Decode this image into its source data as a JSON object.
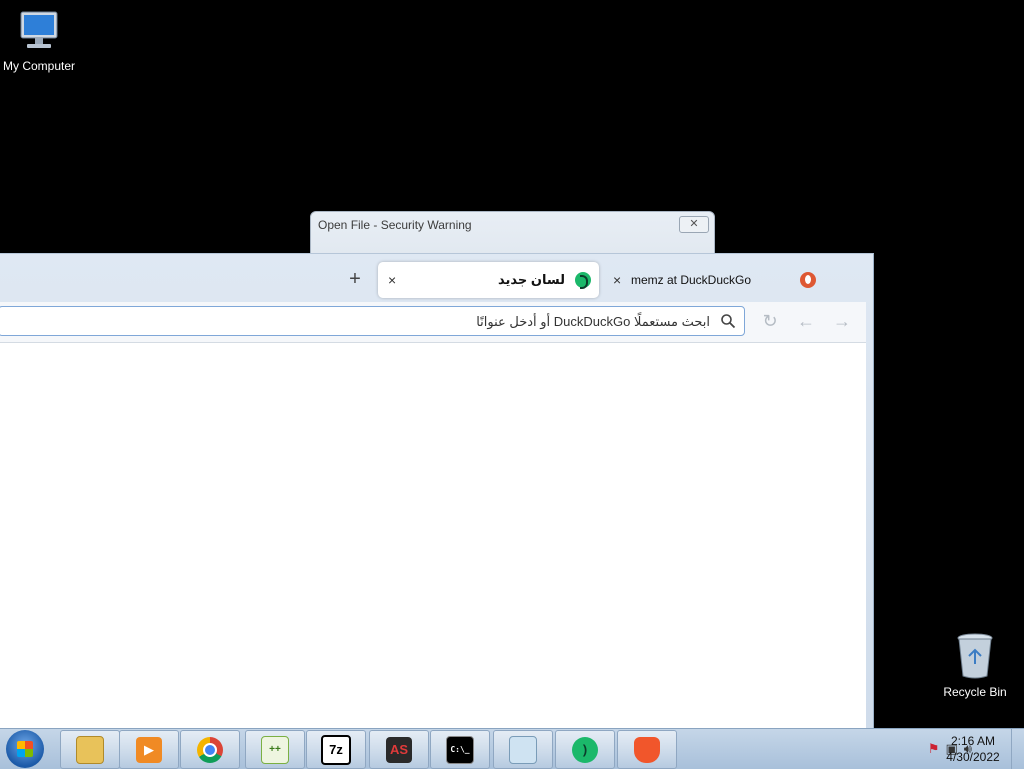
{
  "desktop": {
    "icons": [
      {
        "label": "My Computer",
        "icon": "computer-icon"
      },
      {
        "label": "Recycle Bin",
        "icon": "recycle-bin-icon"
      }
    ]
  },
  "security_warning": {
    "title": "Open File - Security Warning",
    "close_glyph": "✕"
  },
  "browser": {
    "tabs": [
      {
        "label": "لسان جديد",
        "close": "×",
        "icon": "duckduckgo-green-icon",
        "active": true
      },
      {
        "label": "memz at DuckDuckGo",
        "close": "×",
        "icon": "",
        "active": false
      }
    ],
    "new_tab_glyph": "+",
    "address_placeholder": "ابحث مستعملًا DuckDuckGo أو أدخل عنوانًا",
    "nav": {
      "reload": "↻",
      "back": "←",
      "forward": "→"
    }
  },
  "taskbar": {
    "items": [
      {
        "name": "file-explorer",
        "icon": "folder-icon"
      },
      {
        "name": "media-player",
        "icon": "media-player-icon"
      },
      {
        "name": "chrome",
        "icon": "chrome-icon"
      },
      {
        "name": "notepad-plus-plus",
        "icon": "notepad-plus-plus-icon"
      },
      {
        "name": "7zip",
        "icon": "7zip-icon",
        "text": "7z"
      },
      {
        "name": "as-app",
        "icon": "as-icon",
        "text": "AS"
      },
      {
        "name": "command-prompt",
        "icon": "cmd-icon",
        "text": "C:\\_"
      },
      {
        "name": "notepad",
        "icon": "notepad-icon"
      },
      {
        "name": "duckduckgo-browser",
        "icon": "duckduckgo-icon"
      },
      {
        "name": "brave",
        "icon": "brave-icon"
      }
    ],
    "clock_time": "2:16 AM",
    "clock_date": "4/30/2022"
  },
  "colors": {
    "desktop_bg": "#000000",
    "ddg_green": "#1bb86a",
    "ddg_orange": "#de5833"
  }
}
